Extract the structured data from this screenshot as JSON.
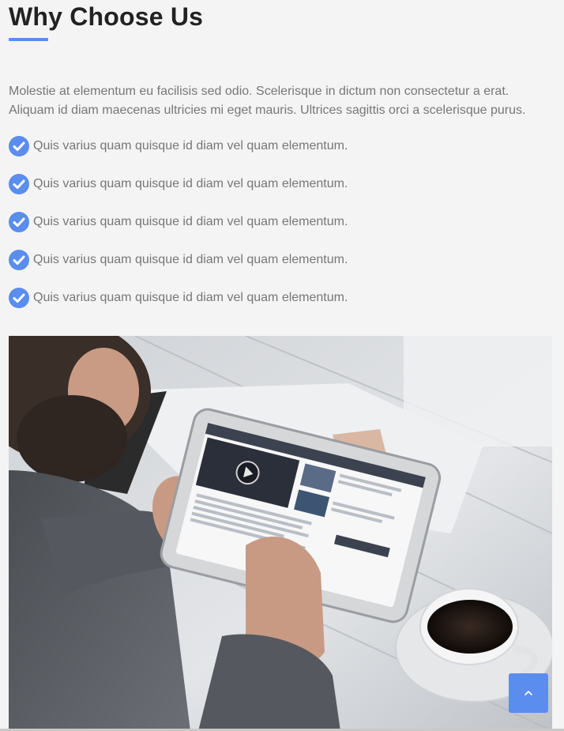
{
  "section": {
    "title": "Why Choose Us",
    "intro": "Molestie at elementum eu facilisis sed odio. Scelerisque in dictum non consectetur a erat. Aliquam id diam maecenas ultricies mi eget mauris. Ultrices sagittis orci a scelerisque purus.",
    "items": [
      "Quis varius quam quisque id diam vel quam elementum.",
      "Quis varius quam quisque id diam vel quam elementum.",
      "Quis varius quam quisque id diam vel quam elementum.",
      "Quis varius quam quisque id diam vel quam elementum.",
      "Quis varius quam quisque id diam vel quam elementum."
    ]
  },
  "icons": {
    "check": "check-circle-icon",
    "scroll_top": "chevron-up-icon"
  },
  "colors": {
    "accent": "#5a8dee",
    "text_muted": "#777777",
    "heading": "#222222",
    "background": "#f4f4f4"
  }
}
